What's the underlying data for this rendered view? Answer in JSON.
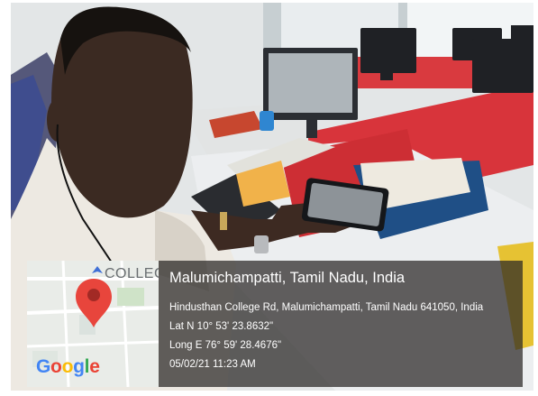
{
  "map": {
    "label": "COLLEG",
    "logo_letters": [
      {
        "ch": "G",
        "color": "#4285F4"
      },
      {
        "ch": "o",
        "color": "#EA4335"
      },
      {
        "ch": "o",
        "color": "#FBBC05"
      },
      {
        "ch": "g",
        "color": "#4285F4"
      },
      {
        "ch": "l",
        "color": "#34A853"
      },
      {
        "ch": "e",
        "color": "#EA4335"
      }
    ],
    "pin_color": "#E8453C",
    "pin_icon": "map-pin-icon"
  },
  "location": {
    "title": "Malumichampatti, Tamil Nadu, India",
    "address": "Hindusthan College Rd, Malumichampatti, Tamil Nadu 641050, India",
    "latitude": "Lat N 10° 53' 23.8632\"",
    "longitude": "Long E 76° 59' 28.4676\"",
    "datetime": "05/02/21 11:23 AM"
  }
}
